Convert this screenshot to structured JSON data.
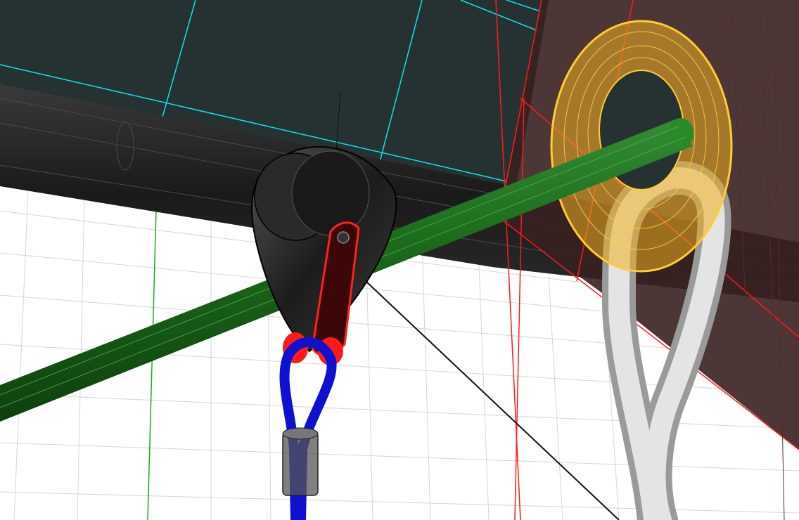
{
  "viewport": {
    "background_color": "#ffffff",
    "grid_color": "#d9d9d9",
    "ceiling_color": "#263232",
    "beam_color": "#262626",
    "sail_edge_color": "#ff0000"
  },
  "objects": [
    {
      "name": "green-rod",
      "color": "#1a6b1a"
    },
    {
      "name": "torus-ring",
      "color": "#f0b020"
    },
    {
      "name": "pulley-block",
      "color": "#2a2a2a"
    },
    {
      "name": "pulley-sideplate",
      "color": "#ff2020"
    },
    {
      "name": "blue-rope",
      "color": "#1010d0"
    },
    {
      "name": "white-rope",
      "color": "#c8c8c8"
    },
    {
      "name": "sleeve",
      "color": "#666666"
    },
    {
      "name": "cyan-guide-lines",
      "color": "#00e0ff"
    },
    {
      "name": "red-plane",
      "color": "#5a2828"
    }
  ]
}
